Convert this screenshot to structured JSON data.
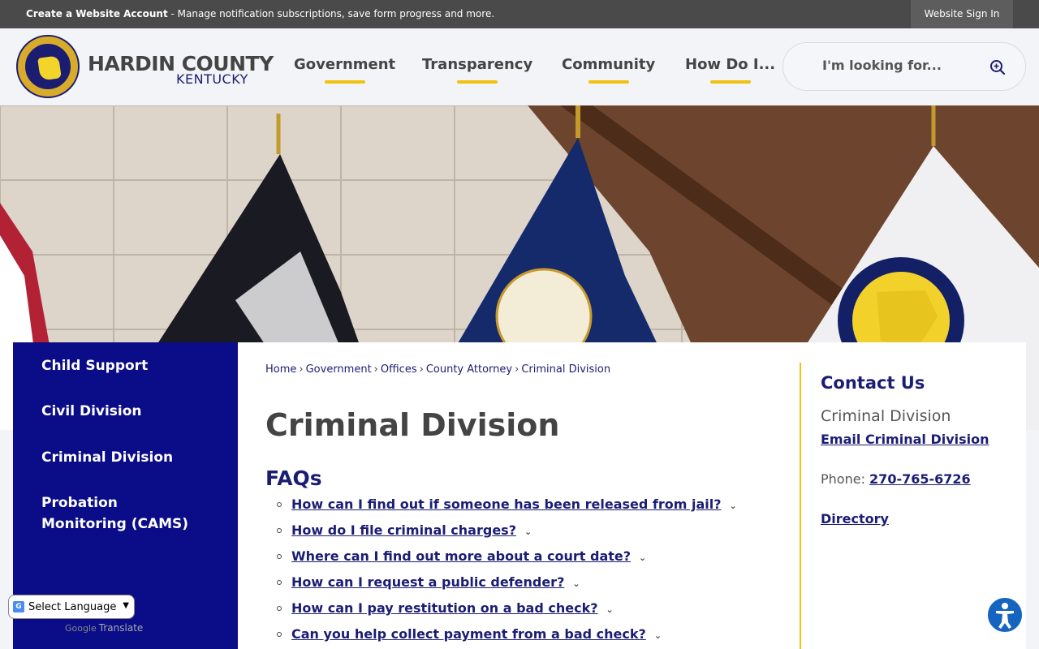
{
  "topbar": {
    "create_account": "Create a Website Account",
    "tagline": " - Manage notification subscriptions, save form progress and more.",
    "sign_in": "Website Sign In"
  },
  "logo": {
    "line1": "HARDIN COUNTY",
    "line2": "KENTUCKY"
  },
  "nav": [
    {
      "label": "Government"
    },
    {
      "label": "Transparency"
    },
    {
      "label": "Community"
    },
    {
      "label": "How Do I..."
    }
  ],
  "search": {
    "placeholder": "I'm looking for..."
  },
  "sidebar": {
    "items": [
      {
        "label": "Child Support"
      },
      {
        "label": "Civil Division"
      },
      {
        "label": "Criminal Division"
      },
      {
        "label": "Probation Monitoring (CAMS)"
      }
    ]
  },
  "breadcrumb": [
    {
      "label": "Home"
    },
    {
      "label": "Government"
    },
    {
      "label": "Offices"
    },
    {
      "label": "County Attorney"
    },
    {
      "label": "Criminal Division"
    }
  ],
  "breadcrumb_sep": "›",
  "page": {
    "title": "Criminal Division",
    "faq_heading": "FAQs"
  },
  "faqs": [
    {
      "q": "How can I find out if someone has been released from jail?"
    },
    {
      "q": "How do I file criminal charges?"
    },
    {
      "q": "Where can I find out more about a court date?"
    },
    {
      "q": "How can I request a public defender?"
    },
    {
      "q": "How can I pay restitution on a bad check?"
    },
    {
      "q": "Can you help collect payment from a bad check?"
    }
  ],
  "contact": {
    "heading": "Contact Us",
    "dept": "Criminal Division",
    "email_link": "Email Criminal Division",
    "phone_label": "Phone: ",
    "phone": "270-765-6726",
    "directory": "Directory"
  },
  "translate": {
    "select_label": "Select Language",
    "powered_by": "Google",
    "translate_word": "Translate"
  },
  "colors": {
    "navy": "#0b0c87",
    "gold": "#f1c20d",
    "link": "#1b1d73"
  }
}
